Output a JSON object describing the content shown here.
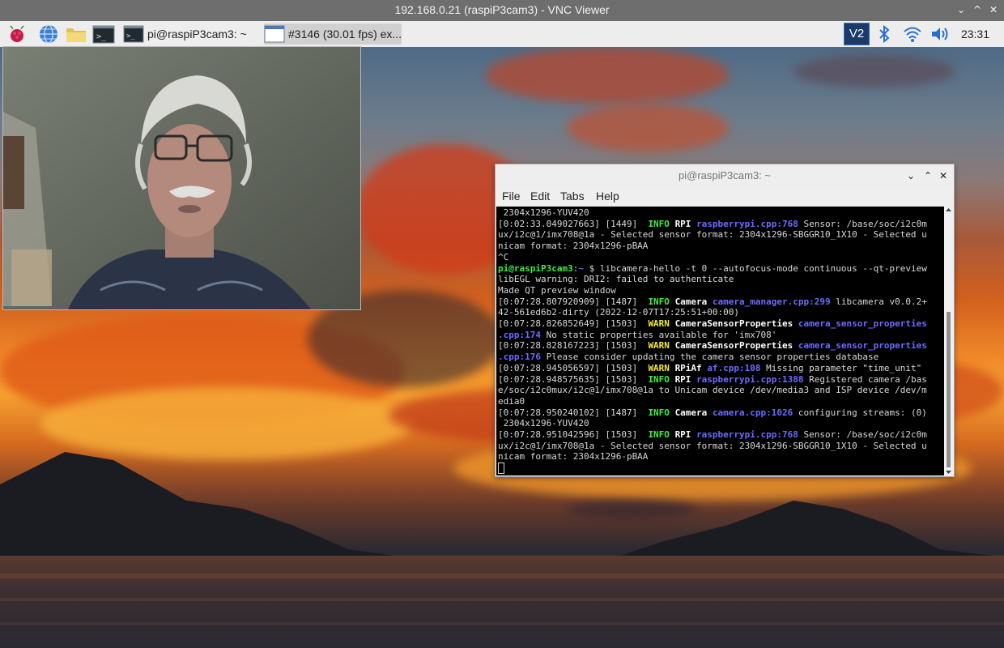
{
  "vnc": {
    "title": "192.168.0.21 (raspiP3cam3) - VNC Viewer",
    "minimize": "⌄",
    "maximize": "^",
    "close": "✕"
  },
  "panel": {
    "launchers": [
      "raspberry-menu-icon",
      "web-browser-icon",
      "file-manager-icon",
      "terminal-icon"
    ],
    "tasks": [
      {
        "label": "pi@raspiP3cam3: ~",
        "icon": "terminal-icon"
      },
      {
        "label": "#3146 (30.01 fps) ex...",
        "icon": "camera-preview-window-icon"
      }
    ],
    "tray": {
      "vnc_label": "V2",
      "bluetooth": "bluetooth-icon",
      "wifi": "wifi-icon",
      "volume": "volume-icon",
      "clock": "23:31"
    },
    "colors": {
      "vnc_tray": "#1a3a6a"
    }
  },
  "terminal": {
    "title": "pi@raspiP3cam3: ~",
    "controls": {
      "minimize": "⌄",
      "maximize": "⌃",
      "close": "✕"
    },
    "menu": [
      "File",
      "Edit",
      "Tabs",
      "Help"
    ],
    "lines": [
      [
        {
          "t": " 2304x1296-YUV420"
        }
      ],
      [
        {
          "t": "[0:02:33.049027663] [1449]  "
        },
        {
          "t": "INFO",
          "s": "info"
        },
        {
          "t": " "
        },
        {
          "t": "RPI",
          "s": "cat"
        },
        {
          "t": " "
        },
        {
          "t": "raspberrypi.cpp:768",
          "s": "file"
        },
        {
          "t": " Sensor: /base/soc/i2c0m"
        }
      ],
      [
        {
          "t": "ux/i2c@1/imx708@1a - Selected sensor format: 2304x1296-SBGGR10_1X10 - Selected u"
        }
      ],
      [
        {
          "t": "nicam format: 2304x1296-pBAA"
        }
      ],
      [
        {
          "t": "^C"
        }
      ],
      [
        {
          "t": "pi@raspiP3cam3",
          "s": "prompt"
        },
        {
          "t": ":"
        },
        {
          "t": "~",
          "s": "path"
        },
        {
          "t": " $ libcamera-hello -t 0 --autofocus-mode continuous --qt-preview"
        }
      ],
      [
        {
          "t": "libEGL warning: DRI2: failed to authenticate"
        }
      ],
      [
        {
          "t": "Made QT preview window"
        }
      ],
      [
        {
          "t": "[0:07:28.807920909] [1487]  "
        },
        {
          "t": "INFO",
          "s": "info"
        },
        {
          "t": " "
        },
        {
          "t": "Camera",
          "s": "cat"
        },
        {
          "t": " "
        },
        {
          "t": "camera_manager.cpp:299",
          "s": "file"
        },
        {
          "t": " libcamera v0.0.2+"
        }
      ],
      [
        {
          "t": "42-561ed6b2-dirty (2022-12-07T17:25:51+00:00)"
        }
      ],
      [
        {
          "t": "[0:07:28.826852649] [1503]  "
        },
        {
          "t": "WARN",
          "s": "warn"
        },
        {
          "t": " "
        },
        {
          "t": "CameraSensorProperties",
          "s": "cat"
        },
        {
          "t": " "
        },
        {
          "t": "camera_sensor_properties",
          "s": "file"
        }
      ],
      [
        {
          "t": ".cpp:174",
          "s": "file"
        },
        {
          "t": " No static properties available for 'imx708'"
        }
      ],
      [
        {
          "t": "[0:07:28.828167223] [1503]  "
        },
        {
          "t": "WARN",
          "s": "warn"
        },
        {
          "t": " "
        },
        {
          "t": "CameraSensorProperties",
          "s": "cat"
        },
        {
          "t": " "
        },
        {
          "t": "camera_sensor_properties",
          "s": "file"
        }
      ],
      [
        {
          "t": ".cpp:176",
          "s": "file"
        },
        {
          "t": " Please consider updating the camera sensor properties database"
        }
      ],
      [
        {
          "t": "[0:07:28.945056597] [1503]  "
        },
        {
          "t": "WARN",
          "s": "warn"
        },
        {
          "t": " "
        },
        {
          "t": "RPiAf",
          "s": "cat"
        },
        {
          "t": " "
        },
        {
          "t": "af.cpp:108",
          "s": "file"
        },
        {
          "t": " Missing parameter \"time_unit\""
        }
      ],
      [
        {
          "t": "[0:07:28.948575635] [1503]  "
        },
        {
          "t": "INFO",
          "s": "info"
        },
        {
          "t": " "
        },
        {
          "t": "RPI",
          "s": "cat"
        },
        {
          "t": " "
        },
        {
          "t": "raspberrypi.cpp:1388",
          "s": "file"
        },
        {
          "t": " Registered camera /bas"
        }
      ],
      [
        {
          "t": "e/soc/i2c0mux/i2c@1/imx708@1a to Unicam device /dev/media3 and ISP device /dev/m"
        }
      ],
      [
        {
          "t": "edia0"
        }
      ],
      [
        {
          "t": "[0:07:28.950240102] [1487]  "
        },
        {
          "t": "INFO",
          "s": "info"
        },
        {
          "t": " "
        },
        {
          "t": "Camera",
          "s": "cat"
        },
        {
          "t": " "
        },
        {
          "t": "camera.cpp:1026",
          "s": "file"
        },
        {
          "t": " configuring streams: (0)"
        }
      ],
      [
        {
          "t": " 2304x1296-YUV420"
        }
      ],
      [
        {
          "t": "[0:07:28.951042596] [1503]  "
        },
        {
          "t": "INFO",
          "s": "info"
        },
        {
          "t": " "
        },
        {
          "t": "RPI",
          "s": "cat"
        },
        {
          "t": " "
        },
        {
          "t": "raspberrypi.cpp:768",
          "s": "file"
        },
        {
          "t": " Sensor: /base/soc/i2c0m"
        }
      ],
      [
        {
          "t": "ux/i2c@1/imx708@1a - Selected sensor format: 2304x1296-SBGGR10_1X10 - Selected u"
        }
      ],
      [
        {
          "t": "nicam format: 2304x1296-pBAA"
        }
      ]
    ]
  },
  "preview": {
    "content": "camera-preview-person-image"
  }
}
